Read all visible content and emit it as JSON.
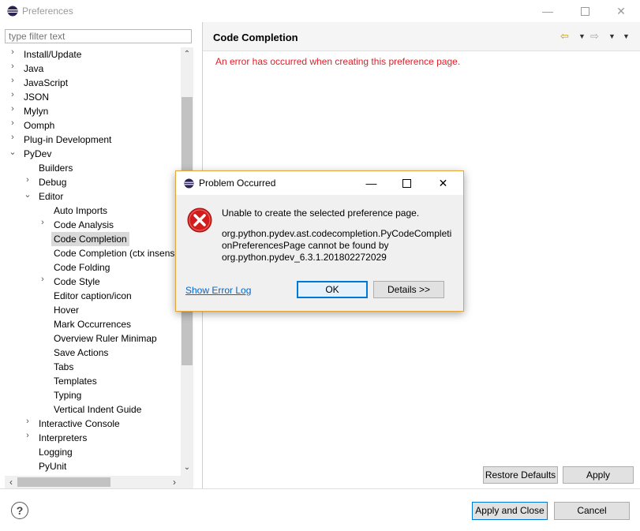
{
  "window": {
    "title": "Preferences"
  },
  "filter": {
    "placeholder": "type filter text"
  },
  "tree": {
    "items": [
      {
        "label": "Install/Update",
        "twisty": "›"
      },
      {
        "label": "Java",
        "twisty": "›"
      },
      {
        "label": "JavaScript",
        "twisty": "›"
      },
      {
        "label": "JSON",
        "twisty": "›"
      },
      {
        "label": "Mylyn",
        "twisty": "›"
      },
      {
        "label": "Oomph",
        "twisty": "›"
      },
      {
        "label": "Plug-in Development",
        "twisty": "›"
      },
      {
        "label": "PyDev",
        "twisty": "⌄"
      },
      {
        "label": "Builders",
        "twisty": ""
      },
      {
        "label": "Debug",
        "twisty": "›"
      },
      {
        "label": "Editor",
        "twisty": "⌄"
      },
      {
        "label": "Auto Imports",
        "twisty": ""
      },
      {
        "label": "Code Analysis",
        "twisty": "›"
      },
      {
        "label": "Code Completion",
        "twisty": ""
      },
      {
        "label": "Code Completion (ctx insensi",
        "twisty": ""
      },
      {
        "label": "Code Folding",
        "twisty": ""
      },
      {
        "label": "Code Style",
        "twisty": "›"
      },
      {
        "label": "Editor caption/icon",
        "twisty": ""
      },
      {
        "label": "Hover",
        "twisty": ""
      },
      {
        "label": "Mark Occurrences",
        "twisty": ""
      },
      {
        "label": "Overview Ruler Minimap",
        "twisty": ""
      },
      {
        "label": "Save Actions",
        "twisty": ""
      },
      {
        "label": "Tabs",
        "twisty": ""
      },
      {
        "label": "Templates",
        "twisty": ""
      },
      {
        "label": "Typing",
        "twisty": ""
      },
      {
        "label": "Vertical Indent Guide",
        "twisty": ""
      },
      {
        "label": "Interactive Console",
        "twisty": "›"
      },
      {
        "label": "Interpreters",
        "twisty": "›"
      },
      {
        "label": "Logging",
        "twisty": ""
      },
      {
        "label": "PyUnit",
        "twisty": ""
      }
    ]
  },
  "page": {
    "title": "Code Completion",
    "error": "An error has occurred when creating this preference page."
  },
  "buttons": {
    "restore_defaults": "Restore Defaults",
    "apply": "Apply",
    "apply_and_close": "Apply and Close",
    "cancel": "Cancel"
  },
  "dialog": {
    "title": "Problem Occurred",
    "message": "Unable to create the selected preference page.",
    "detail_line1": "org.python.pydev.ast.codecompletion.PyCodeCompleti",
    "detail_line2": "onPreferencesPage cannot be found by",
    "detail_line3": "org.python.pydev_6.3.1.201802272029",
    "link": "Show Error Log",
    "ok": "OK",
    "details": "Details >>"
  },
  "colors": {
    "error_text": "#e0202a",
    "link": "#0066cc",
    "dialog_border": "#e5a43a",
    "selection": "#d9d9d9"
  }
}
